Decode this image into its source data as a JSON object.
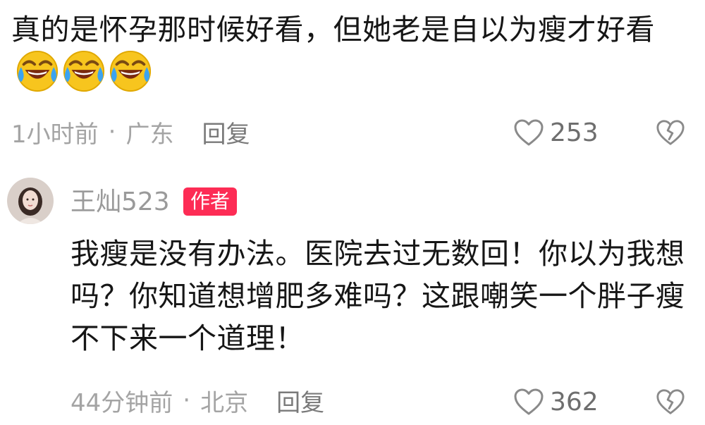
{
  "comments": [
    {
      "text": "真的是怀孕那时候好看，但她老是自以为瘦才好看",
      "emojis": [
        "laughing-crying-emoji",
        "laughing-crying-emoji",
        "laughing-crying-emoji"
      ],
      "time": "1小时前",
      "separator": "·",
      "location": "广东",
      "reply_label": "回复",
      "like_count": "253"
    },
    {
      "username": "王灿523",
      "badge": "作者",
      "text": "我瘦是没有办法。医院去过无数回！你以为我想吗？你知道想增肥多难吗？这跟嘲笑一个胖子瘦不下来一个道理！",
      "time": "44分钟前",
      "separator": "·",
      "location": "北京",
      "reply_label": "回复",
      "like_count": "362"
    }
  ],
  "icons": {
    "like": "heart-outline-icon",
    "dislike": "broken-heart-outline-icon",
    "avatar": "user-avatar"
  },
  "colors": {
    "badge_bg": "#fd2c55",
    "meta_text": "#a4a4a4",
    "body_text": "#161616"
  }
}
